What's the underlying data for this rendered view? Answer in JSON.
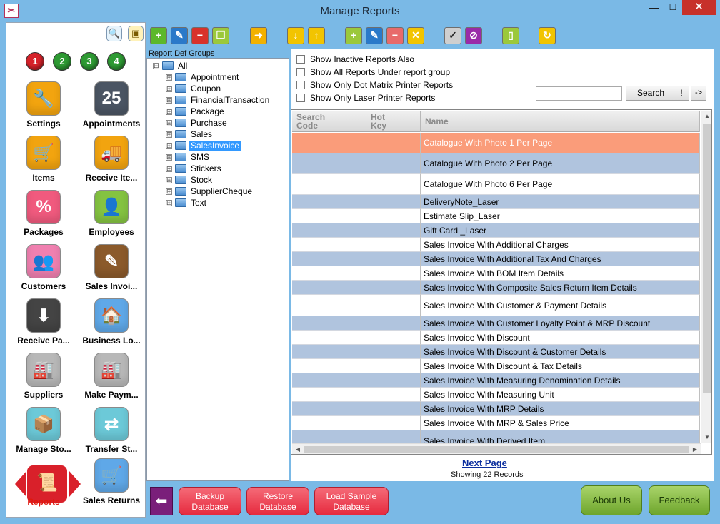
{
  "window": {
    "title": "Manage Reports",
    "icon_glyph": "✂",
    "min_glyph": "—",
    "max_glyph": "☐",
    "close_glyph": "✕"
  },
  "sidebar": {
    "tools": [
      {
        "name": "search-icon",
        "glyph": "🔍"
      },
      {
        "name": "chat-icon",
        "glyph": "▣"
      }
    ],
    "numbers": [
      {
        "label": "1",
        "color": "#d6222a"
      },
      {
        "label": "2",
        "color": "#2e9a33"
      },
      {
        "label": "3",
        "color": "#2e9a33"
      },
      {
        "label": "4",
        "color": "#2e9a33"
      }
    ],
    "modules": [
      {
        "label": "Settings",
        "glyph": "🔧",
        "color": "#f2a40f",
        "icon": "wrench-icon"
      },
      {
        "label": "Appointments",
        "glyph": "25",
        "color": "#4b5563",
        "icon": "calendar-icon"
      },
      {
        "label": "Items",
        "glyph": "🛒",
        "color": "#f2a40f",
        "icon": "cart-icon"
      },
      {
        "label": "Receive Ite...",
        "glyph": "🚚",
        "color": "#f2a40f",
        "icon": "truck-icon"
      },
      {
        "label": "Packages",
        "glyph": "%",
        "color": "#f05a7e",
        "icon": "percent-icon"
      },
      {
        "label": "Employees",
        "glyph": "👤",
        "color": "#84c341",
        "icon": "person-icon"
      },
      {
        "label": "Customers",
        "glyph": "👥",
        "color": "#f080b0",
        "icon": "people-icon"
      },
      {
        "label": "Sales Invoi...",
        "glyph": "✎",
        "color": "#8b5a2b",
        "icon": "invoice-pen-icon"
      },
      {
        "label": "Receive Pa...",
        "glyph": "⬇",
        "color": "#444444",
        "icon": "receive-payment-icon"
      },
      {
        "label": "Business Lo...",
        "glyph": "🏠",
        "color": "#5fa8e8",
        "icon": "house-icon"
      },
      {
        "label": "Suppliers",
        "glyph": "🏭",
        "color": "#b8b8b8",
        "icon": "factory-icon"
      },
      {
        "label": "Make Paym...",
        "glyph": "🏭",
        "color": "#b8b8b8",
        "icon": "factory-payment-icon"
      },
      {
        "label": "Manage Sto...",
        "glyph": "📦",
        "color": "#6cc9d8",
        "icon": "stock-icon"
      },
      {
        "label": "Transfer St...",
        "glyph": "⇄",
        "color": "#6cc9d8",
        "icon": "transfer-icon"
      },
      {
        "label": "Reports",
        "glyph": "📜",
        "color": "#d9202a",
        "icon": "scroll-icon"
      },
      {
        "label": "Sales Returns",
        "glyph": "🛒",
        "color": "#5fa8e8",
        "icon": "return-cart-icon"
      }
    ]
  },
  "toolbar": {
    "buttons": [
      {
        "name": "add",
        "glyph": "+",
        "color": "#5cb82b"
      },
      {
        "name": "edit",
        "glyph": "✎",
        "color": "#2a79c9"
      },
      {
        "name": "delete",
        "glyph": "−",
        "color": "#d8322b"
      },
      {
        "name": "copy",
        "glyph": "❐",
        "color": "#9bc83b"
      },
      {
        "name": "move",
        "glyph": "➜",
        "color": "#f2b100"
      },
      {
        "name": "import",
        "glyph": "↓",
        "color": "#f2c400"
      },
      {
        "name": "export",
        "glyph": "↑",
        "color": "#f2c400"
      },
      {
        "name": "add-doc",
        "glyph": "+",
        "color": "#9bc83b"
      },
      {
        "name": "edit-doc",
        "glyph": "✎",
        "color": "#2a79c9"
      },
      {
        "name": "remove-doc",
        "glyph": "−",
        "color": "#e86a6a"
      },
      {
        "name": "cancel",
        "glyph": "✕",
        "color": "#f2c400"
      },
      {
        "name": "approve",
        "glyph": "✓",
        "color": "#cfcfcf"
      },
      {
        "name": "block",
        "glyph": "⊘",
        "color": "#9a2aa8"
      },
      {
        "name": "new-doc",
        "glyph": "▯",
        "color": "#9bc83b"
      },
      {
        "name": "refresh",
        "glyph": "↻",
        "color": "#f2c400"
      }
    ]
  },
  "tree": {
    "label": "Report Def Groups",
    "root": "All",
    "expander": "⊞",
    "collapse": "⊟",
    "items": [
      "Appointment",
      "Coupon",
      "FinancialTransaction",
      "Package",
      "Purchase",
      "Sales",
      "SalesInvoice",
      "SMS",
      "Stickers",
      "Stock",
      "SupplierCheque",
      "Text"
    ],
    "selected": "SalesInvoice"
  },
  "filters": {
    "options": [
      "Show Inactive Reports Also",
      "Show All Reports Under report group",
      "Show Only Dot Matrix Printer Reports",
      "Show Only Laser Printer Reports"
    ],
    "search_button": "Search",
    "bang_button": "!",
    "go_button": "->"
  },
  "grid": {
    "headers": {
      "code": "Search\nCode",
      "hotkey": "Hot\nKey",
      "name": "Name"
    },
    "rows": [
      "Catalogue With Photo 1 Per Page",
      "Catalogue With Photo 2 Per Page",
      "Catalogue With Photo 6 Per Page",
      "DeliveryNote_Laser",
      "Estimate Slip_Laser",
      "Gift Card _Laser",
      "Sales Invoice With Additional Charges",
      "Sales Invoice With Additional Tax And Charges",
      "Sales Invoice With BOM Item Details",
      "Sales Invoice With Composite Sales Return Item Details",
      "Sales Invoice With Customer & Payment Details",
      "Sales Invoice With Customer Loyalty Point & MRP Discount",
      "Sales Invoice With Discount",
      "Sales Invoice With Discount & Customer Details",
      "Sales Invoice With Discount & Tax Details",
      "Sales Invoice With Measuring Denomination Details",
      "Sales Invoice With Measuring Unit",
      "Sales Invoice With MRP  Details",
      "Sales Invoice With MRP & Sales Price",
      "Sales Invoice With Derived Item"
    ],
    "scroll_up": "▲",
    "scroll_down": "▼",
    "scroll_left": "◀",
    "scroll_right": "▶"
  },
  "paging": {
    "next": "Next Page",
    "showing": "Showing 22 Records"
  },
  "bottom": {
    "back_glyph": "⬅",
    "backup": "Backup\nDatabase",
    "restore": "Restore\nDatabase",
    "load_sample": "Load Sample\nDatabase",
    "about": "About Us",
    "feedback": "Feedback"
  }
}
